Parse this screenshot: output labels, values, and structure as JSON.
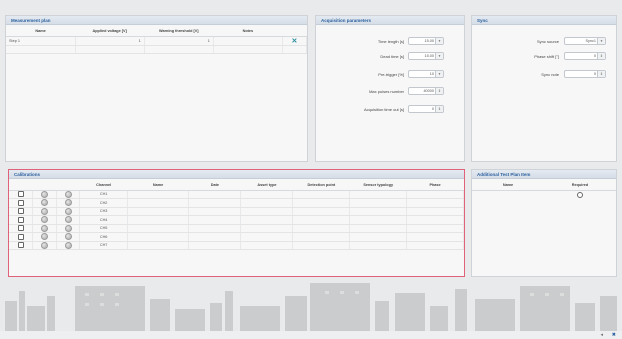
{
  "measurement_plan": {
    "title": "Measurement plan",
    "columns": [
      "Name",
      "Applied voltage [V]",
      "Warning threshold [V]",
      "Notes"
    ],
    "rows": [
      {
        "name": "Step 1",
        "voltage": "1",
        "threshold": "1",
        "notes": ""
      }
    ],
    "delete_icon": "close-icon"
  },
  "acquisition": {
    "title": "Acquisition parameters",
    "fields": [
      {
        "label": "Time length [s]",
        "value": "15.00",
        "control": "dropdown"
      },
      {
        "label": "Dead time [s]",
        "value": "15.00",
        "control": "dropdown"
      },
      {
        "label": "Pre-trigger [%]",
        "value": "10",
        "control": "dropdown"
      },
      {
        "label": "Max pulses number",
        "value": "40000",
        "control": "spinner"
      },
      {
        "label": "Acquisition time out [s]",
        "value": "0",
        "control": "spinner"
      }
    ]
  },
  "sync": {
    "title": "Sync",
    "fields": [
      {
        "label": "Sync source",
        "value": "Sync1",
        "control": "dropdown"
      },
      {
        "label": "Phase shift [°]",
        "value": "0",
        "control": "spinner"
      },
      {
        "label": "Sync note",
        "value": "0",
        "control": "spinner"
      }
    ]
  },
  "calibrations": {
    "title": "Calibrations",
    "columns": [
      "Channel",
      "Name",
      "Date",
      "Asset type",
      "Detection point",
      "Sensor typology",
      "Phase"
    ],
    "rows": [
      {
        "channel": "CH1"
      },
      {
        "channel": "CH2"
      },
      {
        "channel": "CH3"
      },
      {
        "channel": "CH4"
      },
      {
        "channel": "CH5"
      },
      {
        "channel": "CH6"
      },
      {
        "channel": "CH7"
      }
    ],
    "highlight_color": "#e0617a"
  },
  "additional_test_plan": {
    "title": "Additional Test Plan Item",
    "columns": [
      "Name",
      "Required"
    ]
  },
  "footer": {
    "icons": [
      "prev-icon",
      "next-icon"
    ]
  },
  "colors": {
    "accent": "#2a5f9e",
    "background": "#e9eaeb",
    "skyline": "#c9cacb"
  }
}
